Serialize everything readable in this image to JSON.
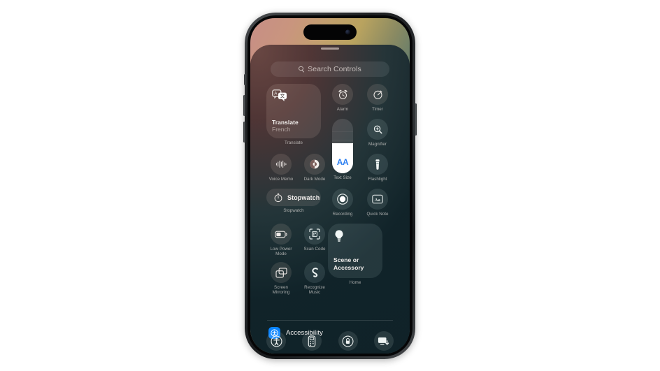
{
  "device": {
    "name": "iphone-control-center",
    "dynamic_island": "dynamic-island",
    "side_buttons": [
      "silent-switch",
      "volume-up",
      "volume-down",
      "power-button"
    ]
  },
  "wallpaper": {
    "gradient_start": "#c78e86",
    "gradient_mid": "#b9a35f",
    "gradient_end": "#27484e"
  },
  "colors": {
    "accent_blue": "#0a84ff",
    "text_size_blue": "#2a7ef0",
    "tile_white": "#ffffff",
    "label": "#e2dedc"
  },
  "search": {
    "placeholder": "Search Controls",
    "icon": "search-icon"
  },
  "controls": {
    "translate": {
      "title": "Translate",
      "subtitle": "French",
      "label": "Translate",
      "icon": "translate-bubbles-icon"
    },
    "alarm": {
      "label": "Alarm",
      "icon": "alarm-clock-icon"
    },
    "timer": {
      "label": "Timer",
      "icon": "timer-icon"
    },
    "magnifier": {
      "label": "Magnifier",
      "icon": "magnifier-icon"
    },
    "text_size": {
      "label": "Text Size",
      "icon": "aa-text-icon",
      "glyph": "AA",
      "fill_percent": 55
    },
    "voice_memo": {
      "label": "Voice Memo",
      "icon": "waveform-icon"
    },
    "dark_mode": {
      "label": "Dark Mode",
      "icon": "dark-mode-circle-icon"
    },
    "flashlight": {
      "label": "Flashlight",
      "icon": "flashlight-icon"
    },
    "stopwatch": {
      "title": "Stopwatch",
      "label": "Stopwatch",
      "icon": "stopwatch-icon"
    },
    "recording": {
      "label": "Recording",
      "icon": "record-dot-icon"
    },
    "quick_note": {
      "label": "Quick Note",
      "icon": "quick-note-icon"
    },
    "low_power": {
      "label": "Low Power Mode",
      "icon": "battery-icon"
    },
    "scan_code": {
      "label": "Scan Code",
      "icon": "scan-code-icon"
    },
    "screen_mirroring": {
      "label": "Screen Mirroring",
      "icon": "screen-mirroring-icon"
    },
    "recognize_music": {
      "label": "Recognize Music",
      "icon": "shazam-icon"
    },
    "home": {
      "title": "Scene or Accessory",
      "label": "Home",
      "icon": "lightbulb-icon"
    }
  },
  "accessibility": {
    "label": "Accessibility",
    "icon": "accessibility-badge-icon"
  },
  "dock": {
    "items": [
      {
        "name": "accessibility-person-icon",
        "label": "Accessibility"
      },
      {
        "name": "remote-icon",
        "label": "Apple TV Remote"
      },
      {
        "name": "rotation-lock-icon",
        "label": "Rotation Lock"
      },
      {
        "name": "screen-mirroring-dock-icon",
        "label": "Screen Mirroring"
      }
    ]
  }
}
